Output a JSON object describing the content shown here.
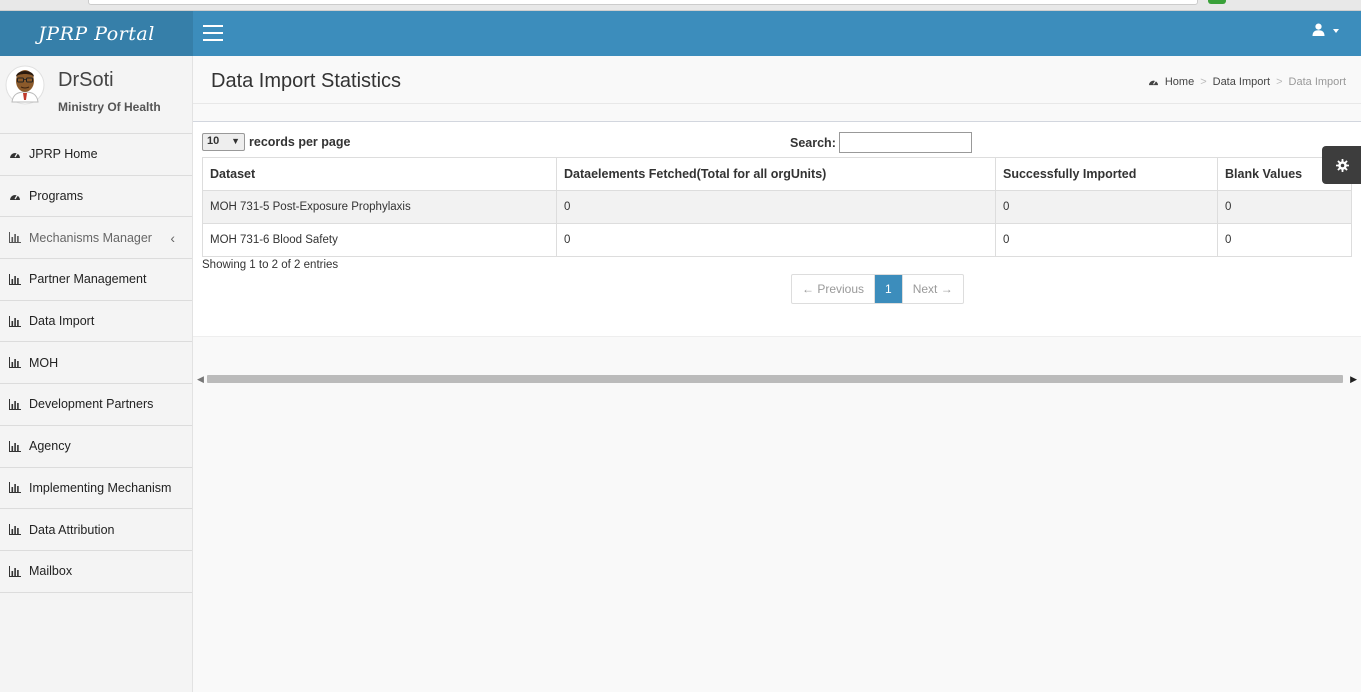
{
  "app": {
    "logo_text": "JPRP Portal"
  },
  "user": {
    "name": "DrSoti",
    "org": "Ministry Of Health"
  },
  "sidebar": {
    "items": [
      {
        "label": "JPRP Home",
        "icon": "dashboard-icon"
      },
      {
        "label": "Programs",
        "icon": "dashboard-icon"
      },
      {
        "label": "Mechanisms Manager",
        "icon": "bar-chart-icon",
        "has_children": true
      },
      {
        "label": "Partner Management",
        "icon": "bar-chart-icon"
      },
      {
        "label": "Data Import",
        "icon": "bar-chart-icon"
      },
      {
        "label": "MOH",
        "icon": "bar-chart-icon"
      },
      {
        "label": "Development Partners",
        "icon": "bar-chart-icon"
      },
      {
        "label": "Agency",
        "icon": "bar-chart-icon"
      },
      {
        "label": "Implementing Mechanism",
        "icon": "bar-chart-icon"
      },
      {
        "label": "Data Attribution",
        "icon": "bar-chart-icon"
      },
      {
        "label": "Mailbox",
        "icon": "bar-chart-icon"
      }
    ]
  },
  "header": {
    "title": "Data Import Statistics",
    "breadcrumb": {
      "home": "Home",
      "section": "Data Import",
      "current": "Data Import"
    }
  },
  "table_controls": {
    "page_size": "10",
    "records_label": "records per page",
    "search_label": "Search:",
    "search_value": ""
  },
  "table": {
    "columns": [
      "Dataset",
      "Dataelements Fetched(Total for all orgUnits)",
      "Successfully Imported",
      "Blank Values"
    ],
    "rows": [
      [
        "MOH 731-5 Post-Exposure Prophylaxis",
        "0",
        "0",
        "0"
      ],
      [
        "MOH 731-6 Blood Safety",
        "0",
        "0",
        "0"
      ]
    ],
    "info": "Showing 1 to 2 of 2 entries"
  },
  "pagination": {
    "previous": "← Previous",
    "current": "1",
    "next": "Next →"
  },
  "colors": {
    "header": "#3c8dbc",
    "logo_bg": "#367fa9",
    "sidebar": "#f4f4f4",
    "settings_bg": "#3d3d3d"
  }
}
